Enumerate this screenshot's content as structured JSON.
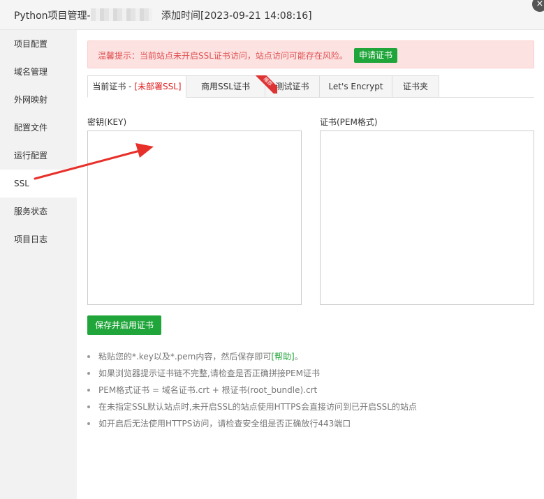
{
  "window": {
    "title_prefix": "Python项目管理-",
    "title_time": "添加时间[2023-09-21 14:08:16]",
    "close_glyph": "×"
  },
  "sidebar": {
    "items": [
      {
        "label": "项目配置"
      },
      {
        "label": "域名管理"
      },
      {
        "label": "外网映射"
      },
      {
        "label": "配置文件"
      },
      {
        "label": "运行配置"
      },
      {
        "label": "SSL",
        "active": true
      },
      {
        "label": "服务状态"
      },
      {
        "label": "项目日志"
      }
    ]
  },
  "alert": {
    "text": "温馨提示：当前站点未开启SSL证书访问，站点访问可能存在风险。",
    "button": "申请证书"
  },
  "tabs": {
    "current_label": "当前证书 - ",
    "current_status": "[未部署SSL]",
    "commercial": "商用SSL证书",
    "commercial_badge": "推荐",
    "test": "测试证书",
    "letsencrypt": "Let's Encrypt",
    "folder": "证书夹"
  },
  "form": {
    "key_label": "密钥(KEY)",
    "key_value": "",
    "cert_label": "证书(PEM格式)",
    "cert_value": "",
    "save_button": "保存并启用证书"
  },
  "tips": {
    "tip1_prefix": "粘贴您的*.key以及*.pem内容，然后保存即可",
    "tip1_link": "[帮助]",
    "tip1_suffix": "。",
    "tip2": "如果浏览器提示证书链不完整,请检查是否正确拼接PEM证书",
    "tip3": "PEM格式证书 = 域名证书.crt + 根证书(root_bundle).crt",
    "tip4": "在未指定SSL默认站点时,未开启SSL的站点使用HTTPS会直接访问到已开启SSL的站点",
    "tip5": "如开启后无法使用HTTPS访问，请检查安全组是否正确放行443端口"
  },
  "colors": {
    "accent_green": "#20a53a",
    "alert_red": "#e05252",
    "alert_bg": "#fde2e2",
    "annotation_arrow": "#e8302a"
  }
}
